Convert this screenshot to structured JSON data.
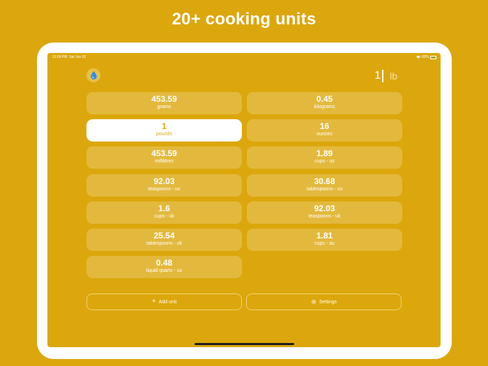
{
  "headline": "20+ cooking units",
  "status_bar": {
    "time": "12:09 PM",
    "date": "Sat Jun 20",
    "battery": "83%"
  },
  "input": {
    "value": "1",
    "unit": "lb"
  },
  "units": [
    {
      "value": "453.59",
      "label": "grams",
      "active": false
    },
    {
      "value": "0.45",
      "label": "kilograms",
      "active": false
    },
    {
      "value": "1",
      "label": "pounds",
      "active": true
    },
    {
      "value": "16",
      "label": "ounces",
      "active": false
    },
    {
      "value": "453.59",
      "label": "millilitres",
      "active": false
    },
    {
      "value": "1.89",
      "label": "cups - us",
      "active": false
    },
    {
      "value": "92.03",
      "label": "teaspoons - us",
      "active": false
    },
    {
      "value": "30.68",
      "label": "tablespoons - us",
      "active": false
    },
    {
      "value": "1.6",
      "label": "cups - uk",
      "active": false
    },
    {
      "value": "92.03",
      "label": "teaspoons - uk",
      "active": false
    },
    {
      "value": "25.54",
      "label": "tablespoons - uk",
      "active": false
    },
    {
      "value": "1.81",
      "label": "cups - au",
      "active": false
    },
    {
      "value": "0.48",
      "label": "liquid quarts - us",
      "active": false
    }
  ],
  "actions": {
    "add_unit": "Add unit",
    "settings": "Settings"
  },
  "icons": {
    "logo": "water-drop-icon",
    "add": "plus-icon",
    "settings": "gear-icon"
  },
  "colors": {
    "accent": "#DBA70C",
    "card": "#E3B93D",
    "active_card": "#FFFFFF"
  }
}
